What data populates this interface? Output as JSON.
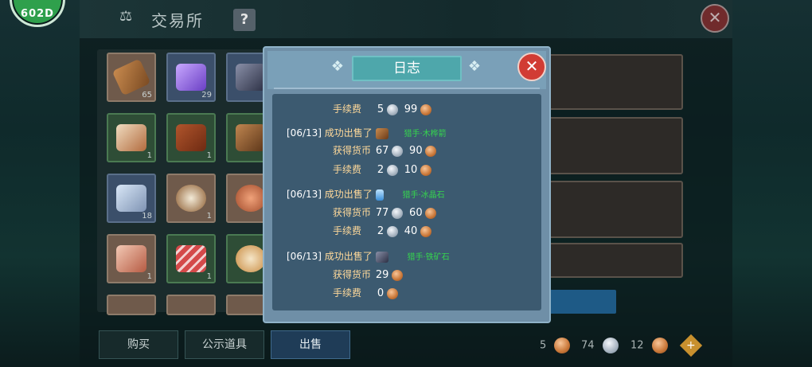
{
  "badge": {
    "text": "602D"
  },
  "window": {
    "title": "交易所",
    "help_label": "?"
  },
  "grid": {
    "slots": [
      {
        "qty": "65"
      },
      {
        "qty": "29"
      },
      {
        "qty": ""
      },
      {
        "qty": "1"
      },
      {
        "qty": "1"
      },
      {
        "qty": ""
      },
      {
        "qty": "18"
      },
      {
        "qty": "1"
      },
      {
        "qty": ""
      },
      {
        "qty": "1"
      },
      {
        "qty": "1"
      },
      {
        "qty": ""
      }
    ]
  },
  "tabs": {
    "buy": "购买",
    "public": "公示道具",
    "sell": "出售"
  },
  "currency": {
    "gold": "5",
    "silver": "74",
    "copper": "12"
  },
  "dialog": {
    "title": "日志",
    "entries": [
      {
        "fee_label": "手续费",
        "fee_a": "5",
        "fee_b": "99"
      },
      {
        "date": "[06/13]",
        "action": "成功出售了",
        "item_note": "猎手·木桦箭",
        "earn_label": "获得货币",
        "earn_a": "67",
        "earn_b": "90",
        "fee_label": "手续费",
        "fee_a": "2",
        "fee_b": "10"
      },
      {
        "date": "[06/13]",
        "action": "成功出售了",
        "item_note": "猎手·冰晶石",
        "earn_label": "获得货币",
        "earn_a": "77",
        "earn_b": "60",
        "fee_label": "手续费",
        "fee_a": "2",
        "fee_b": "40"
      },
      {
        "date": "[06/13]",
        "action": "成功出售了",
        "item_note": "猎手·铁矿石",
        "earn_label": "获得货币",
        "earn_a": "29",
        "fee_label": "手续费",
        "fee_a": "0"
      }
    ]
  },
  "colors": {
    "accent": "#4ea7ab",
    "close": "#d13c34",
    "log_text": "#ffd99a",
    "green": "#35e14b"
  }
}
